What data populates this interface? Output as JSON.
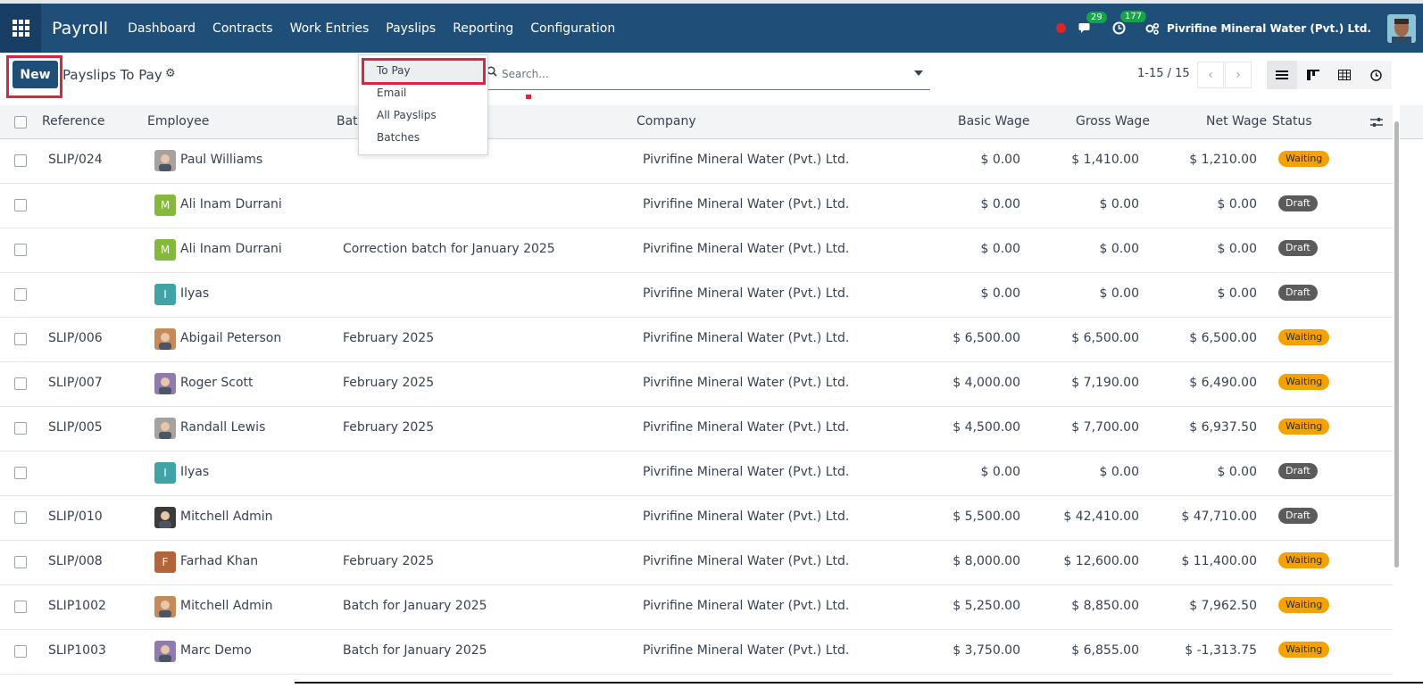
{
  "navbar": {
    "brand": "Payroll",
    "menu": [
      "Dashboard",
      "Contracts",
      "Work Entries",
      "Payslips",
      "Reporting",
      "Configuration"
    ],
    "messages_count": "29",
    "activities_count": "177",
    "company": "Pivrifine Mineral Water (Pvt.) Ltd."
  },
  "control": {
    "new_label": "New",
    "title": "Payslips To Pay",
    "search_placeholder": "Search...",
    "pager": "1-15 / 15"
  },
  "dropdown": {
    "items": [
      "To Pay",
      "Email",
      "All Payslips",
      "Batches"
    ]
  },
  "table": {
    "headers": {
      "reference": "Reference",
      "employee": "Employee",
      "batch": "Bat",
      "company": "Company",
      "basic": "Basic Wage",
      "gross": "Gross Wage",
      "net": "Net Wage",
      "status": "Status"
    },
    "rows": [
      {
        "ref": "SLIP/024",
        "emp": "Paul Williams",
        "batch": "",
        "company": "Pivrifine Mineral Water (Pvt.) Ltd.",
        "basic": "$ 0.00",
        "gross": "$ 1,410.00",
        "net": "$ 1,210.00",
        "status": "Waiting"
      },
      {
        "ref": "",
        "emp": "Ali Inam Durrani",
        "batch": "",
        "company": "Pivrifine Mineral Water (Pvt.) Ltd.",
        "basic": "$ 0.00",
        "gross": "$ 0.00",
        "net": "$ 0.00",
        "status": "Draft",
        "initial": "M"
      },
      {
        "ref": "",
        "emp": "Ali Inam Durrani",
        "batch": "Correction batch for January 2025",
        "company": "Pivrifine Mineral Water (Pvt.) Ltd.",
        "basic": "$ 0.00",
        "gross": "$ 0.00",
        "net": "$ 0.00",
        "status": "Draft",
        "initial": "M"
      },
      {
        "ref": "",
        "emp": "Ilyas",
        "batch": "",
        "company": "Pivrifine Mineral Water (Pvt.) Ltd.",
        "basic": "$ 0.00",
        "gross": "$ 0.00",
        "net": "$ 0.00",
        "status": "Draft",
        "initial": "I"
      },
      {
        "ref": "SLIP/006",
        "emp": "Abigail Peterson",
        "batch": "February 2025",
        "company": "Pivrifine Mineral Water (Pvt.) Ltd.",
        "basic": "$ 6,500.00",
        "gross": "$ 6,500.00",
        "net": "$ 6,500.00",
        "status": "Waiting"
      },
      {
        "ref": "SLIP/007",
        "emp": "Roger Scott",
        "batch": "February 2025",
        "company": "Pivrifine Mineral Water (Pvt.) Ltd.",
        "basic": "$ 4,000.00",
        "gross": "$ 7,190.00",
        "net": "$ 6,490.00",
        "status": "Waiting"
      },
      {
        "ref": "SLIP/005",
        "emp": "Randall Lewis",
        "batch": "February 2025",
        "company": "Pivrifine Mineral Water (Pvt.) Ltd.",
        "basic": "$ 4,500.00",
        "gross": "$ 7,700.00",
        "net": "$ 6,937.50",
        "status": "Waiting"
      },
      {
        "ref": "",
        "emp": "Ilyas",
        "batch": "",
        "company": "Pivrifine Mineral Water (Pvt.) Ltd.",
        "basic": "$ 0.00",
        "gross": "$ 0.00",
        "net": "$ 0.00",
        "status": "Draft",
        "initial": "I"
      },
      {
        "ref": "SLIP/010",
        "emp": "Mitchell Admin",
        "batch": "",
        "company": "Pivrifine Mineral Water (Pvt.) Ltd.",
        "basic": "$ 5,500.00",
        "gross": "$ 42,410.00",
        "net": "$ 47,710.00",
        "status": "Draft"
      },
      {
        "ref": "SLIP/008",
        "emp": "Farhad Khan",
        "batch": "February 2025",
        "company": "Pivrifine Mineral Water (Pvt.) Ltd.",
        "basic": "$ 8,000.00",
        "gross": "$ 12,600.00",
        "net": "$ 11,400.00",
        "status": "Waiting",
        "initial": "F"
      },
      {
        "ref": "SLIP1002",
        "emp": "Mitchell Admin",
        "batch": "Batch for January 2025",
        "company": "Pivrifine Mineral Water (Pvt.) Ltd.",
        "basic": "$ 5,250.00",
        "gross": "$ 8,850.00",
        "net": "$ 7,962.50",
        "status": "Waiting"
      },
      {
        "ref": "SLIP1003",
        "emp": "Marc Demo",
        "batch": "Batch for January 2025",
        "company": "Pivrifine Mineral Water (Pvt.) Ltd.",
        "basic": "$ 3,750.00",
        "gross": "$ 6,855.00",
        "net": "$ -1,313.75",
        "status": "Waiting"
      }
    ]
  },
  "colors": {
    "navbar": "#1f4e79",
    "waiting": "#f5a100",
    "draft": "#5b5b5b",
    "highlight": "#d7263d"
  }
}
